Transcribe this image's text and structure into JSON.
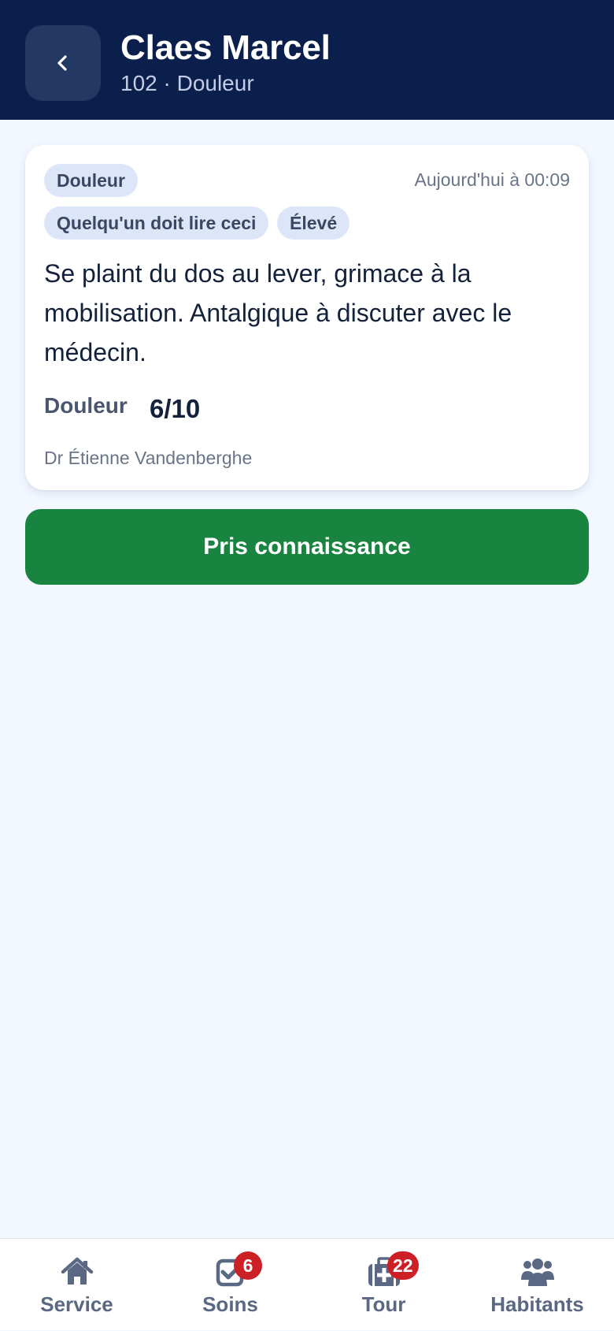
{
  "header": {
    "back_icon": "chevron-left-icon",
    "title": "Claes Marcel",
    "subtitle": "102 · Douleur"
  },
  "note": {
    "category_tag": "Douleur",
    "timestamp": "Aujourd'hui à 00:09",
    "tags": [
      "Quelqu'un doit lire ceci",
      "Élevé"
    ],
    "text": "Se plaint du dos au lever, grimace à la mobilisation. Antalgique à discuter avec le médecin.",
    "metric": {
      "label": "Douleur",
      "value": "6/10"
    },
    "author": "Dr Étienne Vandenberghe"
  },
  "actions": {
    "acknowledge_label": "Pris connaissance",
    "acknowledge_color": "#188440"
  },
  "tabbar": {
    "items": [
      {
        "label": "Service",
        "icon": "home-icon"
      },
      {
        "label": "Soins",
        "icon": "checkbox-icon",
        "badge": "6"
      },
      {
        "label": "Tour",
        "icon": "medical-kit-icon",
        "badge": "22"
      },
      {
        "label": "Habitants",
        "icon": "users-icon"
      }
    ]
  },
  "colors": {
    "header_bg": "#0b1f4d",
    "page_bg": "#f3f7ff",
    "chip_bg": "#dde6f9",
    "badge_bg": "#cd1f26",
    "tab_icon": "#5b6883"
  }
}
